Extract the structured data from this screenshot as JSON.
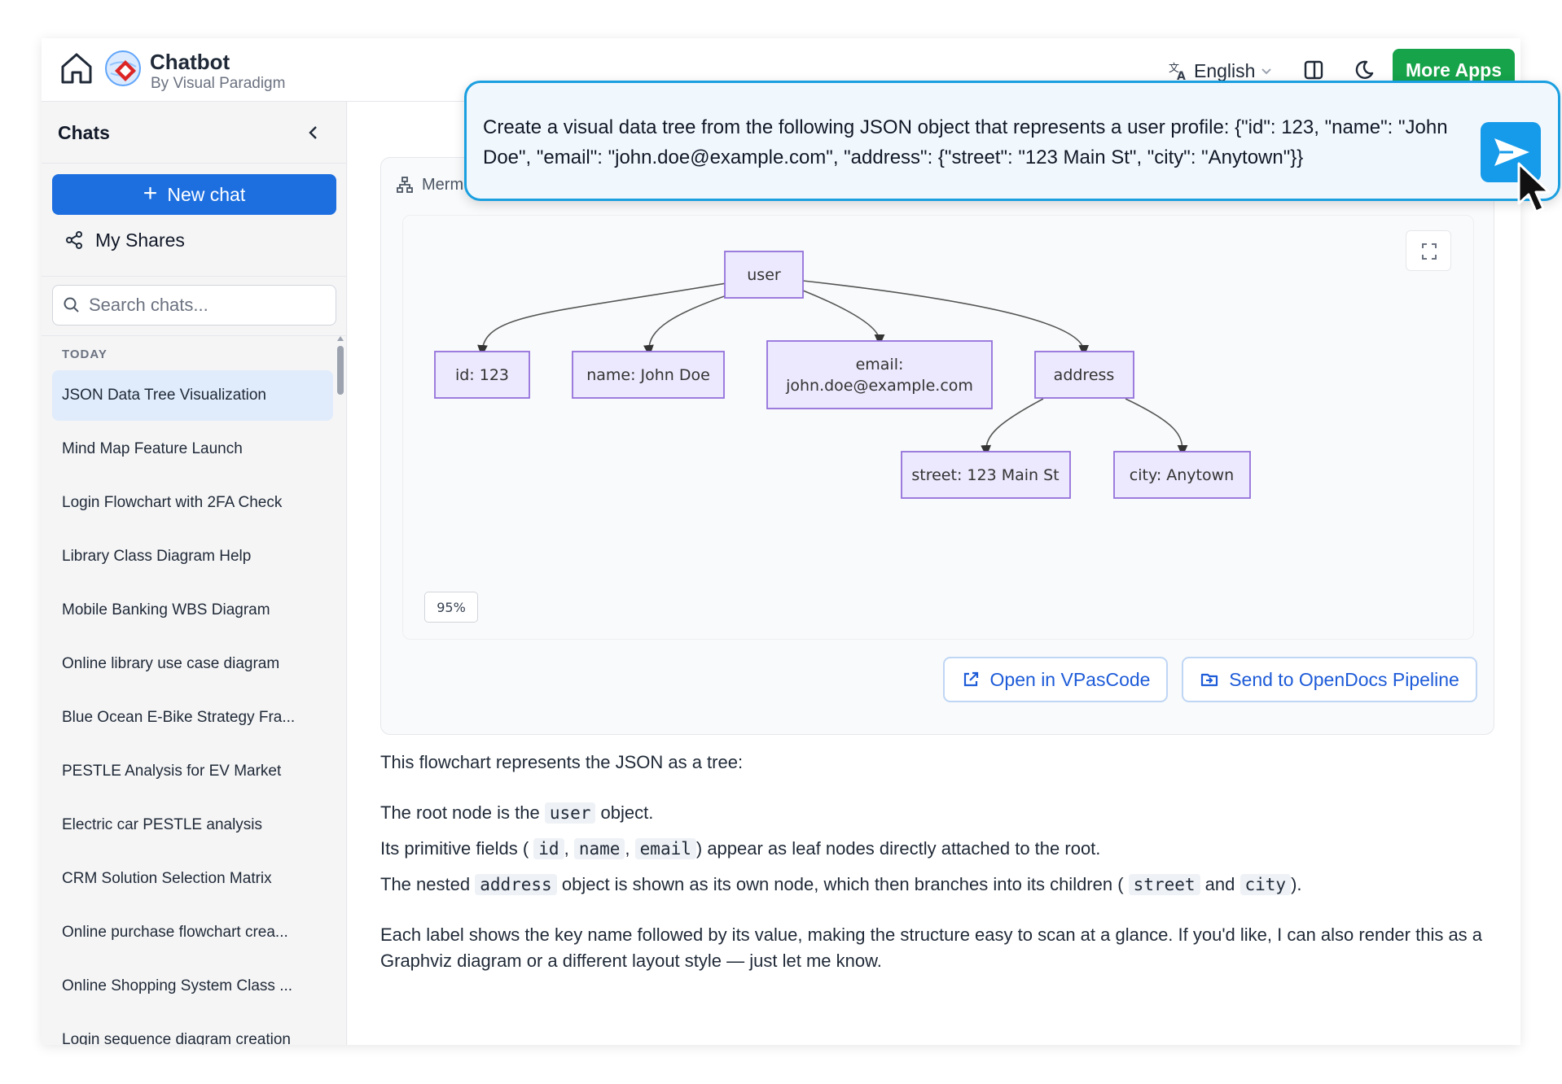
{
  "header": {
    "title": "Chatbot",
    "subtitle": "By Visual Paradigm",
    "language": "English",
    "more_apps": "More Apps"
  },
  "sidebar": {
    "title": "Chats",
    "new_chat": "New chat",
    "my_shares": "My Shares",
    "search_placeholder": "Search chats...",
    "section_label": "TODAY",
    "chats": [
      "JSON Data Tree Visualization",
      "Mind Map Feature Launch",
      "Login Flowchart with 2FA Check",
      "Library Class Diagram Help",
      "Mobile Banking WBS Diagram",
      "Online library use case diagram",
      "Blue Ocean E-Bike Strategy Fra...",
      "PESTLE Analysis for EV Market",
      "Electric car PESTLE analysis",
      "CRM Solution Selection Matrix",
      "Online purchase flowchart crea...",
      "Online Shopping System Class ...",
      "Login sequence diagram creation"
    ],
    "active_index": 0
  },
  "diagram": {
    "tab_label": "Merm",
    "zoom": "95%",
    "nodes": {
      "user": "user",
      "id": "id: 123",
      "name": "name: John Doe",
      "email_line1": "email:",
      "email_line2": "john.doe@example.com",
      "address": "address",
      "street": "street: 123 Main St",
      "city": "city: Anytown"
    },
    "node_fill": "#ece8fd",
    "node_stroke": "#9370db"
  },
  "actions": {
    "open_vpascode": "Open in VPasCode",
    "send_opendocs": "Send to OpenDocs Pipeline"
  },
  "answer": {
    "intro": "This flowchart represents the JSON as a tree:",
    "l1_a": "The root node is the",
    "l1_code": "user",
    "l1_b": "object.",
    "l2_a": "Its primitive fields (",
    "l2_code1": "id",
    "l2_sep1": ",",
    "l2_code2": "name",
    "l2_sep2": ",",
    "l2_code3": "email",
    "l2_b": ") appear as leaf nodes directly attached to the root.",
    "l3_a": "The nested",
    "l3_code1": "address",
    "l3_b": "object is shown as its own node, which then branches into its children (",
    "l3_code2": "street",
    "l3_c": "and",
    "l3_code3": "city",
    "l3_d": ").",
    "outro": "Each label shows the key name followed by its value, making the structure easy to scan at a glance. If you'd like, I can also render this as a Graphviz diagram or a different layout style — just let me know."
  },
  "prompt": {
    "text": "Create a visual data tree from the following JSON object that represents a user profile: {\"id\": 123, \"name\": \"John Doe\", \"email\": \"john.doe@example.com\", \"address\": {\"street\": \"123 Main St\", \"city\": \"Anytown\"}}"
  },
  "colors": {
    "primary": "#1d6fe0",
    "green": "#16a34a",
    "prompt_border": "#1a9fe0",
    "send": "#169bea"
  }
}
